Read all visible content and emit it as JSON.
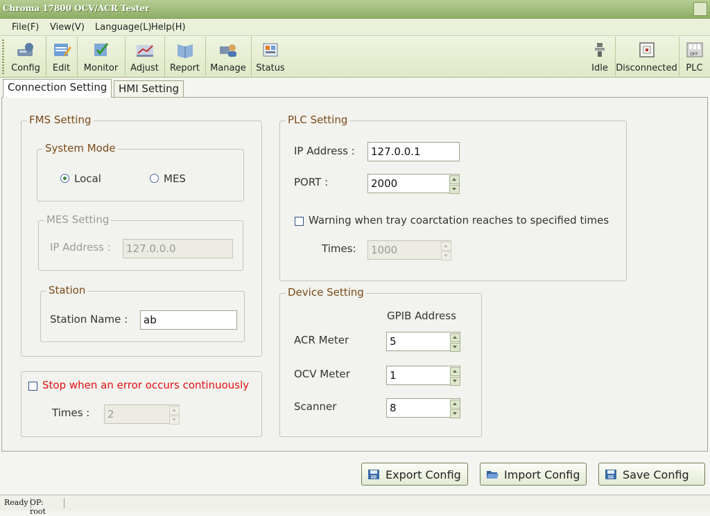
{
  "window": {
    "title": "Chroma 17800 OCV/ACR Tester"
  },
  "menu": [
    "File(F)",
    "View(V)",
    "Language(L)",
    "Help(H)"
  ],
  "toolbar": {
    "left": [
      "Config",
      "Edit",
      "Monitor",
      "Adjust",
      "Report",
      "Manage",
      "Status"
    ],
    "right": [
      "Idle",
      "Disconnected",
      "PLC"
    ]
  },
  "tabs": {
    "connection": "Connection Setting",
    "hmi": "HMI Setting"
  },
  "fms": {
    "title": "FMS Setting",
    "system_mode": {
      "title": "System Mode",
      "local": "Local",
      "mes": "MES",
      "selected": "Local"
    },
    "mes_setting": {
      "title": "MES Setting",
      "ip_label": "IP Address :",
      "ip_value": "127.0.0.0"
    },
    "station": {
      "title": "Station",
      "name_label": "Station Name :",
      "name_value": "ab"
    }
  },
  "stop_error": {
    "label": "Stop when an error occurs continuously",
    "times_label": "Times :",
    "times_value": "2",
    "checked": false
  },
  "plc": {
    "title": "PLC Setting",
    "ip_label": "IP Address :",
    "ip_value": "127.0.0.1",
    "port_label": "PORT :",
    "port_value": "2000",
    "warning_label": "Warning when tray coarctation reaches to specified times",
    "warning_checked": false,
    "times_label": "Times:",
    "times_value": "1000"
  },
  "device": {
    "title": "Device Setting",
    "gpib_header": "GPIB Address",
    "acr_label": "ACR Meter",
    "acr_value": "5",
    "ocv_label": "OCV Meter",
    "ocv_value": "1",
    "scanner_label": "Scanner",
    "scanner_value": "8"
  },
  "buttons": {
    "export": "Export Config",
    "import": "Import Config",
    "save": "Save Config"
  },
  "status": {
    "ready": "Ready",
    "op": "OP:  root"
  },
  "colors": {
    "accent": "#8fae66",
    "legend": "#7a4a18",
    "error_text": "#e01010"
  }
}
